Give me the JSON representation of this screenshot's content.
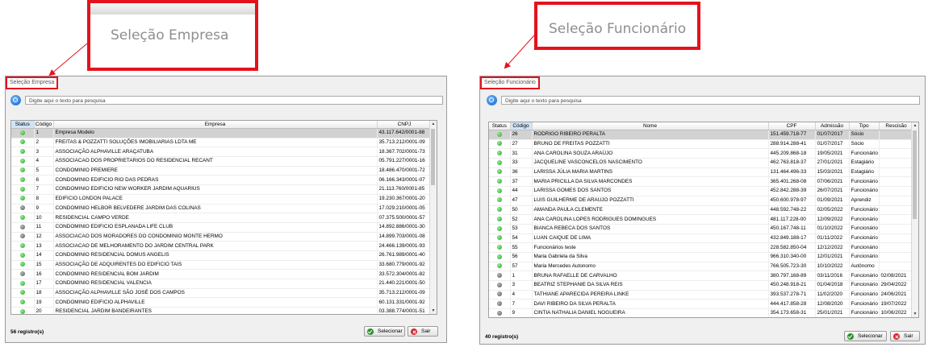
{
  "colors": {
    "highlight": "#e4121c",
    "status_active": "#2b9e2b",
    "status_inactive": "#555555",
    "row_selected": "#d2d2d2"
  },
  "callouts": {
    "left_title": "Seleção Empresa",
    "right_title": "Seleção Funcionário"
  },
  "empresa": {
    "title": "Seleção Empresa",
    "search_placeholder": "Digite aqui o texto para pesquisa",
    "columns": [
      "Status",
      "Código",
      "Empresa",
      "CNPJ"
    ],
    "rows": [
      {
        "status": "green",
        "codigo": "1",
        "empresa": "Empresa Modelo",
        "cnpj": "43.117.642/0001-88"
      },
      {
        "status": "green",
        "codigo": "2",
        "empresa": "FREITAS & POZZATTI SOLUÇÕES IMOBILIARIAS LDTA ME",
        "cnpj": "35.713.212/0001-09"
      },
      {
        "status": "green",
        "codigo": "3",
        "empresa": "ASSOCIAÇÃO ALPHAVILLE ARAÇATUBA",
        "cnpj": "18.367.702/0001-73"
      },
      {
        "status": "green",
        "codigo": "4",
        "empresa": "ASSOCIACAO DOS PROPRIETARIOS DO RESIDENCIAL RECANT",
        "cnpj": "05.791.227/0001-16"
      },
      {
        "status": "green",
        "codigo": "5",
        "empresa": "CONDOMINIO PREMIERE",
        "cnpj": "18.486.470/0001-72"
      },
      {
        "status": "green",
        "codigo": "6",
        "empresa": "CONDOMINIO EDIFICIO RIO DAS PEDRAS",
        "cnpj": "06.166.343/0001-07"
      },
      {
        "status": "green",
        "codigo": "7",
        "empresa": "CONDOMINIO EDIFICIO NEW WORKER JARDIM AQUARIUS",
        "cnpj": "21.113.760/0001-85"
      },
      {
        "status": "green",
        "codigo": "8",
        "empresa": "EDIFICIO LONDON PALACE",
        "cnpj": "19.230.367/0001-20"
      },
      {
        "status": "gray",
        "codigo": "9",
        "empresa": "CONDOMINIO HELBOR BELVEDERE JARDIM DAS COLINAS",
        "cnpj": "17.029.210/0001-05"
      },
      {
        "status": "green",
        "codigo": "10",
        "empresa": "RESIDENCIAL CAMPO VERDE",
        "cnpj": "07.375.500/0001-57"
      },
      {
        "status": "gray",
        "codigo": "11",
        "empresa": "CONDOMINIO EDIFICIO ESPLANADA LIFE CLUB",
        "cnpj": "14.892.886/0001-30"
      },
      {
        "status": "gray",
        "codigo": "12",
        "empresa": "ASSOCIACAO DOS MORADORES DO CONDOMINIO MONTE HERMO",
        "cnpj": "14.899.703/0001-08"
      },
      {
        "status": "green",
        "codigo": "13",
        "empresa": "ASSOCIACAO DE MELHORAMENTO DO JARDIM CENTRAL PARK",
        "cnpj": "24.466.139/0001-93"
      },
      {
        "status": "green",
        "codigo": "14",
        "empresa": "CONDOMINIO RESIDENCIAL DOMUS ANGELIS",
        "cnpj": "26.761.989/0001-40"
      },
      {
        "status": "green",
        "codigo": "15",
        "empresa": "ASSOCIAÇÃO DE ADQUIRENTES DO EDIFICIO TAIS",
        "cnpj": "33.680.779/0001-92"
      },
      {
        "status": "gray",
        "codigo": "16",
        "empresa": "CONDOMINIO RESIDENCIAL BOM JARDIM",
        "cnpj": "33.572.304/0001-82"
      },
      {
        "status": "green",
        "codigo": "17",
        "empresa": "CONDOMINIO RESIDENCIAL VALENCIA",
        "cnpj": "21.440.221/0001-50"
      },
      {
        "status": "green",
        "codigo": "18",
        "empresa": "ASSOCIAÇÃO ALPHAVILLE SÃO JOSÉ DOS CAMPOS",
        "cnpj": "35.713.212/0001-09"
      },
      {
        "status": "green",
        "codigo": "19",
        "empresa": "CONDOMINIO EDIFICIO ALPHAVILLE",
        "cnpj": "60.131.331/0001-92"
      },
      {
        "status": "green",
        "codigo": "20",
        "empresa": "RESIDENCIAL JARDIM BANDEIRANTES",
        "cnpj": "03.388.774/0001-51"
      }
    ],
    "count": "56 registro(s)",
    "btn_select": "Selecionar",
    "btn_exit": "Sair"
  },
  "funcionario": {
    "title": "Seleção Funcionário",
    "search_placeholder": "Digite aqui o texto para pesquisa",
    "columns": [
      "Status",
      "Código",
      "Nome",
      "CPF",
      "Admissão",
      "Tipo",
      "Rescisão"
    ],
    "rows": [
      {
        "status": "green",
        "codigo": "26",
        "nome": "RODRIGO RIBEIRO PERALTA",
        "cpf": "151.459.718-77",
        "admissao": "01/07/2017",
        "tipo": "Sócio",
        "rescisao": ""
      },
      {
        "status": "green",
        "codigo": "27",
        "nome": "BRUNO DE FREITAS POZZATTI",
        "cpf": "288.914.288-41",
        "admissao": "01/07/2017",
        "tipo": "Sócio",
        "rescisao": ""
      },
      {
        "status": "green",
        "codigo": "31",
        "nome": "ANA CAROLINA SOUZA ARAÚJO",
        "cpf": "445.209.868-18",
        "admissao": "19/05/2021",
        "tipo": "Funcionário",
        "rescisao": ""
      },
      {
        "status": "green",
        "codigo": "33",
        "nome": "JACQUELINE VASCONCELOS NASCIMENTO",
        "cpf": "462.763.818-37",
        "admissao": "27/01/2021",
        "tipo": "Estagiário",
        "rescisao": ""
      },
      {
        "status": "green",
        "codigo": "36",
        "nome": "LARISSA JÚLIA MARIA MARTINS",
        "cpf": "131.464.496-33",
        "admissao": "15/03/2021",
        "tipo": "Estagiário",
        "rescisao": ""
      },
      {
        "status": "green",
        "codigo": "37",
        "nome": "MARIA PRICILLA DA SILVA MARCONDES",
        "cpf": "365.401.268-08",
        "admissao": "07/06/2021",
        "tipo": "Funcionário",
        "rescisao": ""
      },
      {
        "status": "green",
        "codigo": "44",
        "nome": "LARISSA GOMES DOS SANTOS",
        "cpf": "452.842.288-39",
        "admissao": "26/07/2021",
        "tipo": "Funcionário",
        "rescisao": ""
      },
      {
        "status": "green",
        "codigo": "47",
        "nome": "LUIS GUILHERME DE ARAUJO POZZATTI",
        "cpf": "450.600.978-97",
        "admissao": "01/09/2021",
        "tipo": "Aprendiz",
        "rescisao": ""
      },
      {
        "status": "green",
        "codigo": "50",
        "nome": "AMANDA PAULA CLEMENTE",
        "cpf": "448.592.748-22",
        "admissao": "02/05/2022",
        "tipo": "Funcionário",
        "rescisao": ""
      },
      {
        "status": "green",
        "codigo": "52",
        "nome": "ANA CAROLINA LOPES RODRIGUES DOMINGUES",
        "cpf": "481.117.228-00",
        "admissao": "12/09/2022",
        "tipo": "Funcionário",
        "rescisao": ""
      },
      {
        "status": "green",
        "codigo": "53",
        "nome": "BIANCA REBECA DOS SANTOS",
        "cpf": "450.167.748-11",
        "admissao": "01/10/2022",
        "tipo": "Funcionário",
        "rescisao": ""
      },
      {
        "status": "green",
        "codigo": "54",
        "nome": "LUAN CAIQUE DE LIMA",
        "cpf": "432.849.188-17",
        "admissao": "01/11/2022",
        "tipo": "Funcionário",
        "rescisao": ""
      },
      {
        "status": "green",
        "codigo": "55",
        "nome": "Funcionários teste",
        "cpf": "228.582.850-04",
        "admissao": "12/12/2022",
        "tipo": "Funcionário",
        "rescisao": ""
      },
      {
        "status": "green",
        "codigo": "56",
        "nome": "Maria Gabriela da Silva",
        "cpf": "966.310.340-00",
        "admissao": "12/01/2021",
        "tipo": "Funcionário",
        "rescisao": ""
      },
      {
        "status": "green",
        "codigo": "57",
        "nome": "Maria Mercedes Autonomo",
        "cpf": "766.505.723-30",
        "admissao": "10/10/2022",
        "tipo": "Autônomo",
        "rescisao": ""
      },
      {
        "status": "gray",
        "codigo": "1",
        "nome": "BRUNA RAFAELLE DE CARVALHO",
        "cpf": "380.797.168-89",
        "admissao": "03/11/2016",
        "tipo": "Funcionário",
        "rescisao": "02/08/2021"
      },
      {
        "status": "gray",
        "codigo": "3",
        "nome": "BEATRIZ STEPHANIE DA SILVA REIS",
        "cpf": "450.248.918-21",
        "admissao": "01/04/2018",
        "tipo": "Funcionário",
        "rescisao": "29/04/2022"
      },
      {
        "status": "gray",
        "codigo": "4",
        "nome": "TATHIANE APARECIDA PEREIRA LINKE",
        "cpf": "393.537.278-71",
        "admissao": "11/02/2020",
        "tipo": "Funcionário",
        "rescisao": "24/06/2021"
      },
      {
        "status": "gray",
        "codigo": "7",
        "nome": "DAVI RIBEIRO DA SILVA PERALTA",
        "cpf": "444.417.858-28",
        "admissao": "12/08/2020",
        "tipo": "Funcionário",
        "rescisao": "19/07/2022"
      },
      {
        "status": "gray",
        "codigo": "9",
        "nome": "CINTIA NATHALIA DANIEL NOGUEIRA",
        "cpf": "354.173.658-31",
        "admissao": "25/01/2021",
        "tipo": "Funcionário",
        "rescisao": "10/06/2022"
      }
    ],
    "count": "40 registro(s)",
    "btn_select": "Selecionar",
    "btn_exit": "Sair"
  }
}
